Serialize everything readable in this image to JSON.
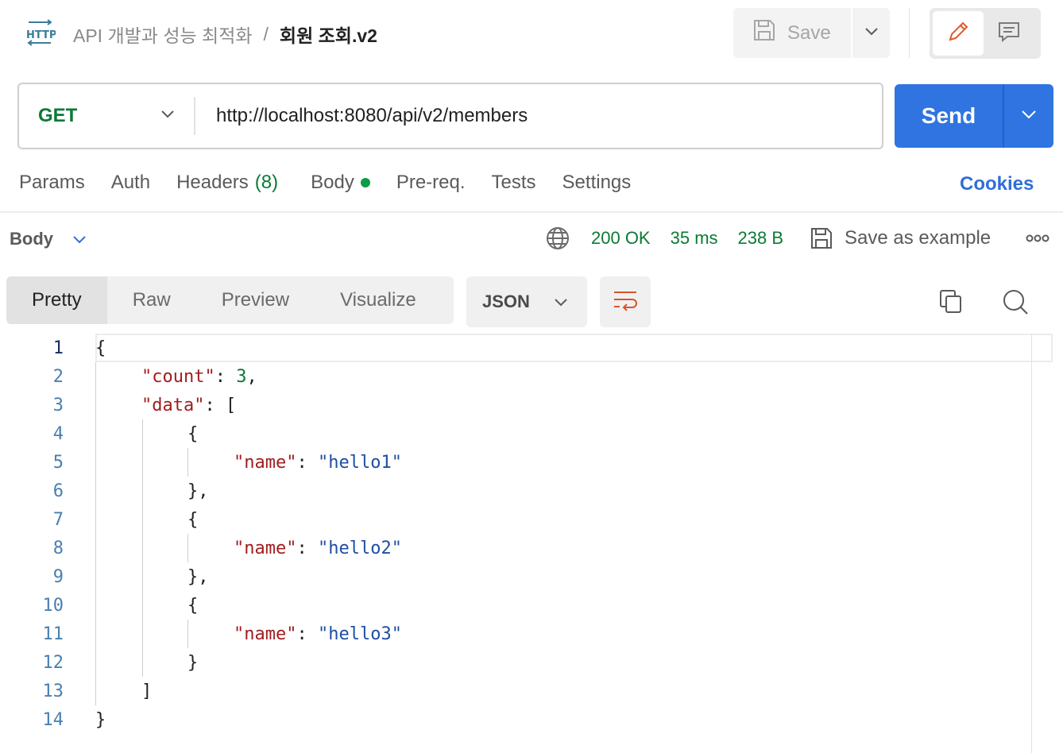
{
  "header": {
    "breadcrumb_parent": "API 개발과 성능 최적화",
    "breadcrumb_separator": "/",
    "breadcrumb_current": "회원 조회.v2",
    "save_label": "Save"
  },
  "request": {
    "method": "GET",
    "url": "http://localhost:8080/api/v2/members",
    "send_label": "Send"
  },
  "request_tabs": {
    "params": "Params",
    "auth": "Auth",
    "headers": "Headers",
    "headers_count": "(8)",
    "body": "Body",
    "prereq": "Pre-req.",
    "tests": "Tests",
    "settings": "Settings",
    "cookies": "Cookies"
  },
  "response": {
    "body_label": "Body",
    "status": "200 OK",
    "time": "35 ms",
    "size": "238 B",
    "save_example": "Save as example",
    "view_tabs": [
      "Pretty",
      "Raw",
      "Preview",
      "Visualize"
    ],
    "format": "JSON",
    "line_numbers": [
      "1",
      "2",
      "3",
      "4",
      "5",
      "6",
      "7",
      "8",
      "9",
      "10",
      "11",
      "12",
      "13",
      "14"
    ],
    "json": {
      "count_key": "\"count\"",
      "count_value": "3",
      "data_key": "\"data\"",
      "name_key": "\"name\"",
      "names": [
        "\"hello1\"",
        "\"hello2\"",
        "\"hello3\""
      ]
    }
  },
  "colors": {
    "send": "#2f74e1",
    "method": "#0b7a35",
    "status": "#0b7a35",
    "cookies": "#2f6fd6",
    "json_key": "#a01e1e",
    "json_string": "#1f4ea3",
    "json_number": "#0b7a35"
  },
  "icons": [
    "http-icon",
    "save-icon",
    "chevron-down-icon",
    "pencil-icon",
    "comment-icon",
    "globe-icon",
    "save-example-icon",
    "more-icon",
    "wrap-lines-icon",
    "copy-icon",
    "search-icon"
  ]
}
